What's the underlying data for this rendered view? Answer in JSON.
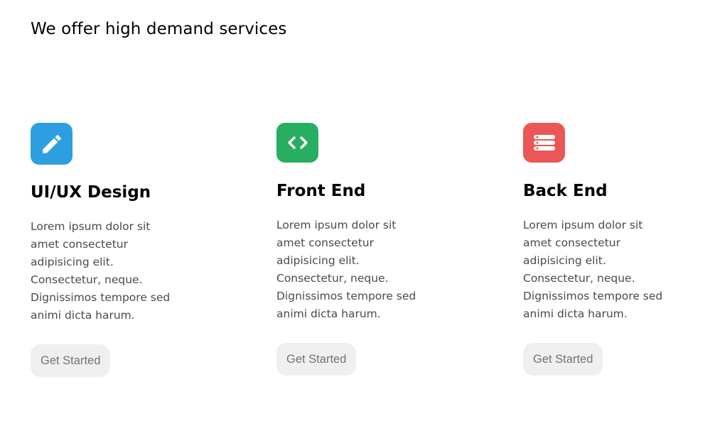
{
  "section": {
    "title": "We offer high demand services"
  },
  "cards": [
    {
      "icon": "pencil-icon",
      "icon_color": "#2d9fe1",
      "title": "UI/UX Design",
      "text": "Lorem ipsum dolor sit amet consectetur adipisicing elit. Consectetur, neque. Dignissimos tempore sed animi dicta harum.",
      "button_label": "Get Started"
    },
    {
      "icon": "code-icon",
      "icon_color": "#27ae60",
      "title": "Front End",
      "text": "Lorem ipsum dolor sit amet consectetur adipisicing elit. Consectetur, neque. Dignissimos tempore sed animi dicta harum.",
      "button_label": "Get Started"
    },
    {
      "icon": "server-icon",
      "icon_color": "#eb5656",
      "title": "Back End",
      "text": "Lorem ipsum dolor sit amet consectetur adipisicing elit. Consectetur, neque. Dignissimos tempore sed animi dicta harum.",
      "button_label": "Get Started"
    }
  ],
  "colors": {
    "button_bg": "#efefef",
    "button_text": "#737373",
    "body_text": "#4a4a4a"
  }
}
